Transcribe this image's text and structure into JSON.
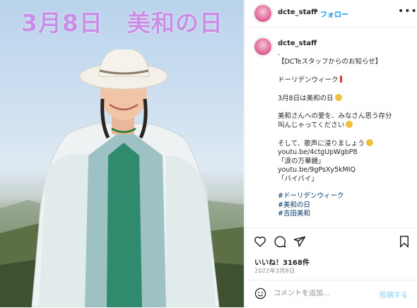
{
  "photo": {
    "overlay_title": "3月8日　美和の日"
  },
  "header": {
    "username": "dcte_staff",
    "separator": "•",
    "follow_label": "フォロー",
    "more_icon": "more-horizontal-icon"
  },
  "caption": {
    "username": "dcte_staff",
    "lines": [
      {
        "text": "."
      },
      {
        "text": "【DCTeスタッフからのお知らせ】"
      },
      {
        "text": ""
      },
      {
        "text": "ドーリデンウィーク",
        "emoji": "bang"
      },
      {
        "text": ""
      },
      {
        "text": "3月8日は美和の日",
        "emoji": "bee"
      },
      {
        "text": ""
      },
      {
        "text": "美和さんへの愛を、みなさん思う存分"
      },
      {
        "text": "叫んじゃってください",
        "emoji": "smile"
      },
      {
        "text": ""
      },
      {
        "text": "そして、歌声に浸りましょう",
        "emoji": "smile"
      },
      {
        "text": "youtu.be/4ctgUpWgbP8"
      },
      {
        "text": "「涙の万華鏡」"
      },
      {
        "text": "youtu.be/9gPsXy5kMIQ"
      },
      {
        "text": "「バイバイ」"
      },
      {
        "text": ""
      },
      {
        "text": "#ドーリデンウィーク",
        "tag": true
      },
      {
        "text": "#美和の日",
        "tag": true
      },
      {
        "text": "#吉田美和",
        "tag": true
      }
    ]
  },
  "actions": {
    "likes": "いいね！3168件",
    "date": "2022年3月8日"
  },
  "comment": {
    "placeholder": "コメントを追加...",
    "post_label": "投稿する"
  },
  "colors": {
    "follow": "#0095f6",
    "hashtag": "#00376b",
    "overlay_title": "#c98ee6",
    "post_disabled": "#b2dffc"
  }
}
